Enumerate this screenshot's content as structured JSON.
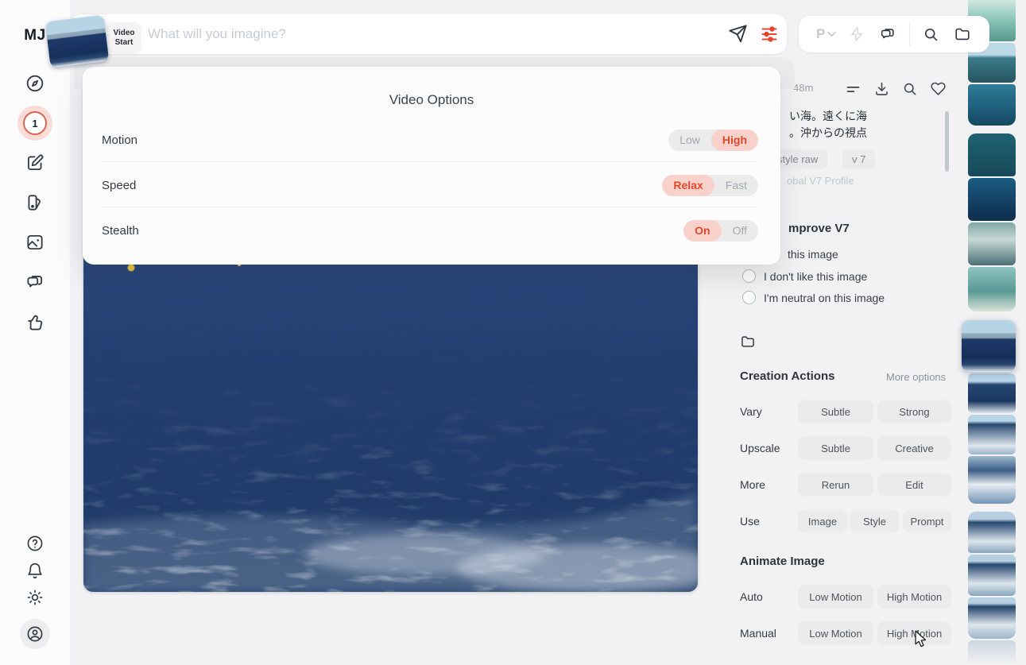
{
  "sidebar": {
    "logo": "MJ",
    "badge_count": "1"
  },
  "topbar": {
    "video_chip_line1": "Video",
    "video_chip_line2": "Start",
    "prompt_placeholder": "What will you imagine?",
    "profile_initial": "P"
  },
  "gallery_header": {
    "time": "48m"
  },
  "prompt_panel": {
    "jp_line1": "い海。遠くに海",
    "jp_line2": "。沖からの視点",
    "tag_style_raw": "style raw",
    "tag_version": "v 7",
    "tag_profile": "obal V7 Profile"
  },
  "improve": {
    "heading": "mprove V7",
    "option_like": "this image",
    "option_dislike": "I don't like this image",
    "option_neutral": "I'm neutral on this image"
  },
  "creation_actions": {
    "title": "Creation Actions",
    "more_options": "More options",
    "rows": [
      {
        "label": "Vary",
        "buttons": [
          "Subtle",
          "Strong"
        ]
      },
      {
        "label": "Upscale",
        "buttons": [
          "Subtle",
          "Creative"
        ]
      },
      {
        "label": "More",
        "buttons": [
          "Rerun",
          "Edit"
        ]
      },
      {
        "label": "Use",
        "buttons": [
          "Image",
          "Style",
          "Prompt"
        ]
      }
    ]
  },
  "animate_image": {
    "title": "Animate Image",
    "rows": [
      {
        "label": "Auto",
        "buttons": [
          "Low Motion",
          "High Motion"
        ]
      },
      {
        "label": "Manual",
        "buttons": [
          "Low Motion",
          "High Motion"
        ]
      }
    ]
  },
  "video_options": {
    "title": "Video Options",
    "rows": [
      {
        "label": "Motion",
        "options": [
          "Low",
          "High"
        ],
        "selected": "High"
      },
      {
        "label": "Speed",
        "options": [
          "Relax",
          "Fast"
        ],
        "selected": "Relax"
      },
      {
        "label": "Stealth",
        "options": [
          "On",
          "Off"
        ],
        "selected": "On"
      }
    ]
  },
  "icons": {
    "sidebar": [
      "explore-compass",
      "queue-badge",
      "create-edit",
      "organize-swatches",
      "gallery-image",
      "chat-bubbles",
      "rate-thumbs-up",
      "help-question",
      "notifications-bell",
      "theme-sun",
      "account-person"
    ],
    "topbar": [
      "send-plane",
      "video-settings-sliders",
      "profile-dropdown-chevron",
      "lightning",
      "chat-bubbles",
      "search-magnifier",
      "folder"
    ],
    "gallery_header": [
      "filter-lines",
      "download-tray",
      "search-magnifier",
      "heart-like"
    ],
    "panel": [
      "folder"
    ]
  },
  "colors": {
    "accent_text": "#e5472d",
    "accent_bg": "#f8d2ca",
    "accent_icon": "#e8432e",
    "badge_ring": "#d96550",
    "sea_deep": "#1d3a69"
  }
}
